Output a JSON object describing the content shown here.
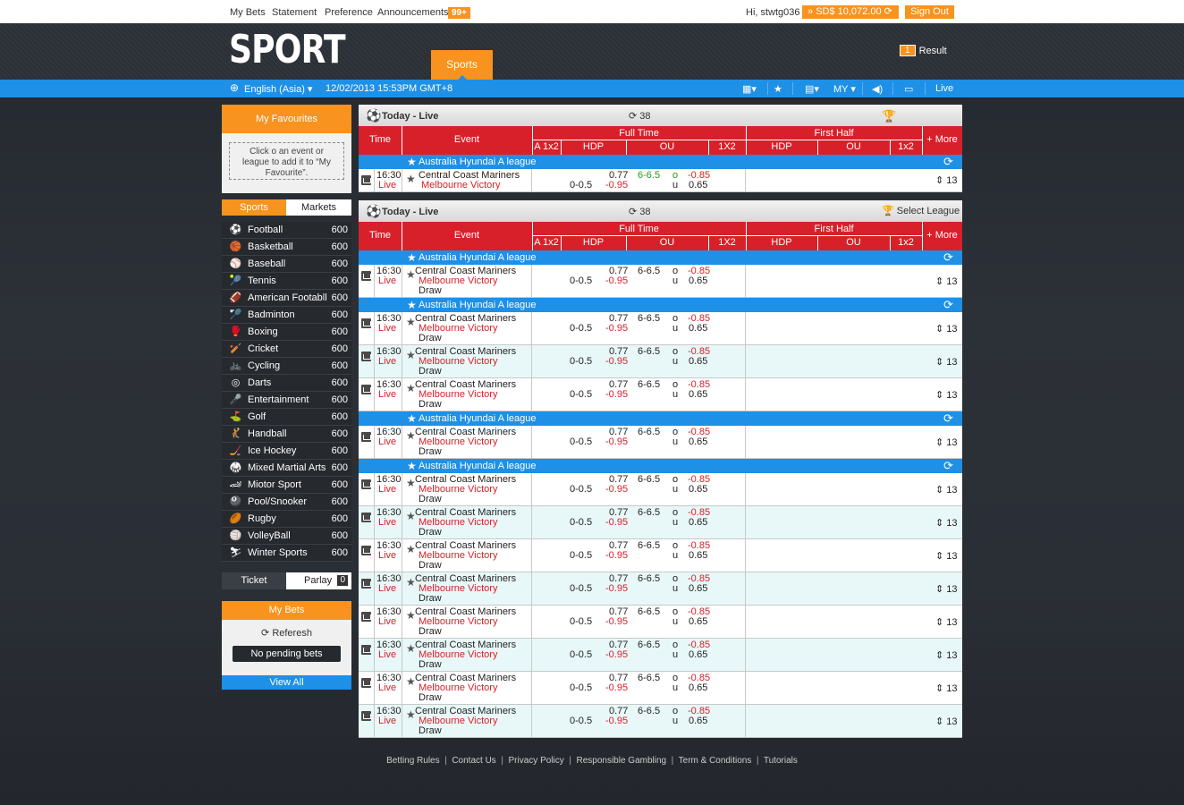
{
  "topbar": {
    "my_bets": "My Bets",
    "statement": "Statement",
    "preference": "Preference",
    "announcements": "Announcements",
    "ann_count": "99+",
    "greeting": "Hi, stwtg036",
    "balance": "SD$  10,072.00",
    "sign_out": "Sign Out"
  },
  "header": {
    "logo": "SPORT",
    "sports_tab": "Sports",
    "result_count": "1",
    "result_label": "Result"
  },
  "bar": {
    "language": "English (Asia)",
    "datetime": "12/02/2013  15:53PM GMT+8",
    "odds_type": "MY",
    "live": "Live"
  },
  "favourites": {
    "title": "My Favourites",
    "hint": "Click o an event or league to add it to “My Favourite”."
  },
  "side_tabs": {
    "sports": "Sports",
    "markets": "Markets"
  },
  "sports": [
    {
      "name": "Football",
      "count": "600",
      "icon": "football-icon"
    },
    {
      "name": "Basketball",
      "count": "600",
      "icon": "basketball-icon"
    },
    {
      "name": "Baseball",
      "count": "600",
      "icon": "baseball-icon"
    },
    {
      "name": "Tennis",
      "count": "600",
      "icon": "tennis-icon"
    },
    {
      "name": "American Footabll",
      "count": "600",
      "icon": "american-football-icon"
    },
    {
      "name": "Badminton",
      "count": "600",
      "icon": "badminton-icon"
    },
    {
      "name": "Boxing",
      "count": "600",
      "icon": "boxing-icon"
    },
    {
      "name": "Cricket",
      "count": "600",
      "icon": "cricket-icon"
    },
    {
      "name": "Cycling",
      "count": "600",
      "icon": "cycling-icon"
    },
    {
      "name": "Darts",
      "count": "600",
      "icon": "darts-icon"
    },
    {
      "name": "Entertainment",
      "count": "600",
      "icon": "entertainment-icon"
    },
    {
      "name": "Golf",
      "count": "600",
      "icon": "golf-icon"
    },
    {
      "name": "Handball",
      "count": "600",
      "icon": "handball-icon"
    },
    {
      "name": "Ice Hockey",
      "count": "600",
      "icon": "ice-hockey-icon"
    },
    {
      "name": "Mixed Martial Arts",
      "count": "600",
      "icon": "mma-icon"
    },
    {
      "name": "Miotor Sport",
      "count": "600",
      "icon": "motor-sport-icon"
    },
    {
      "name": "Pool/Snooker",
      "count": "600",
      "icon": "pool-icon"
    },
    {
      "name": "Rugby",
      "count": "600",
      "icon": "rugby-icon"
    },
    {
      "name": "VolleyBall",
      "count": "600",
      "icon": "volleyball-icon"
    },
    {
      "name": "Winter Sports",
      "count": "600",
      "icon": "winter-sports-icon"
    }
  ],
  "betslip": {
    "ticket": "Ticket",
    "parlay": "Parlay",
    "parlay_count": "0",
    "my_bets": "My Bets",
    "refresh": "Referesh",
    "no_pending": "No pending bets",
    "view_all": "View All"
  },
  "panel1": {
    "title": "Today - Live",
    "count": "38"
  },
  "panel2": {
    "title": "Today - Live",
    "count": "38",
    "select_league": "Select League"
  },
  "columns": {
    "time": "Time",
    "event": "Event",
    "full_time": "Full Time",
    "first_half": "First Half",
    "a1x2": "A 1x2",
    "hdp": "HDP",
    "ou": "OU",
    "x12": "1X2",
    "hdp2": "HDP",
    "ou2": "OU",
    "x12b": "1x2",
    "more": "+ More"
  },
  "league_name": "Australia Hyundai A league",
  "match": {
    "time": "16:30",
    "live": "Live",
    "home": "Central Coast Mariners",
    "away": "Melbourne Victory",
    "draw": "Draw",
    "hdp_line": "0-0.5",
    "hdp_home": "0.77",
    "hdp_away": "-0.95",
    "ou_line": "6-6.5",
    "o": "o",
    "u": "u",
    "ou_over": "-0.85",
    "ou_under": "0.65",
    "more": "13"
  },
  "footer": {
    "links": [
      "Betting Rules",
      "Contact Us",
      "Privacy Policy",
      "Responsible Gambling",
      "Term & Conditions",
      "Tutorials"
    ]
  }
}
